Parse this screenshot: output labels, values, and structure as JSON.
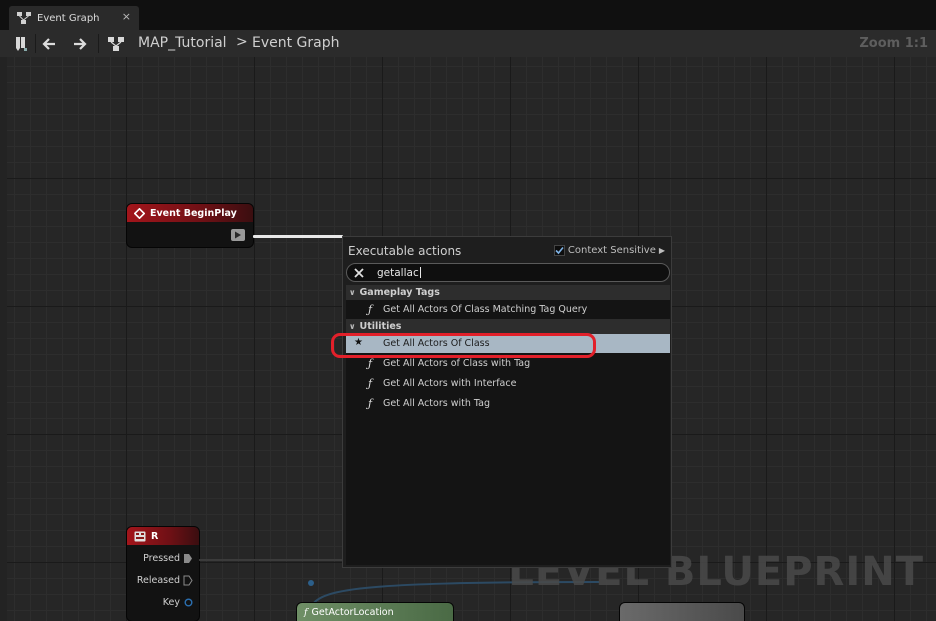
{
  "tab": {
    "label": "Event Graph",
    "close": "×"
  },
  "toolbar": {
    "breadcrumb": [
      "MAP_Tutorial",
      "Event Graph"
    ],
    "separator": ">",
    "zoom": "Zoom 1:1"
  },
  "nodes": {
    "begin_play": {
      "title": "Event BeginPlay"
    },
    "r_key": {
      "title": "R",
      "pins": [
        "Pressed",
        "Released",
        "Key"
      ]
    },
    "get_actor_location": {
      "title": "GetActorLocation"
    }
  },
  "watermark": "LEVEL BLUEPRINT",
  "action_menu": {
    "title": "Executable actions",
    "context_sensitive": {
      "label": "Context Sensitive",
      "checked": true
    },
    "search": {
      "value": "getallac"
    },
    "categories": [
      {
        "name": "Gameplay Tags",
        "items": [
          "Get All Actors Of Class Matching Tag Query"
        ]
      },
      {
        "name": "Utilities",
        "items": [
          "Get All Actors Of Class",
          "Get All Actors of Class with Tag",
          "Get All Actors with Interface",
          "Get All Actors with Tag"
        ]
      }
    ],
    "selected_item": "Get All Actors Of Class"
  },
  "colors": {
    "event_node": "#a3151b",
    "selection": "#a8b7c4",
    "highlight": "#e2202a"
  }
}
